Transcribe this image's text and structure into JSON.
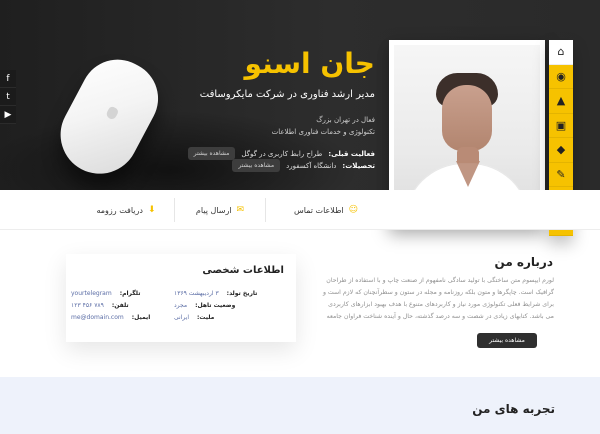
{
  "hero": {
    "name": "جان اسنو",
    "title": "مدیر ارشد فناوری در شرکت مایکروسافت",
    "meta_line1": "فعال در تهران بزرگ",
    "meta_line2": "تکنولوژی و خدمات فناوری اطلاعات",
    "activity_label": "فعالیت قبلی:",
    "activity_text": "طراح رابط کاربری در گوگل",
    "education_label": "تحصیلات:",
    "education_text": "دانشگاه آکسفورد",
    "more_button_1": "مشاهده بیشتر",
    "more_button_2": "مشاهده بیشتر"
  },
  "contact": {
    "contact_label": "اطلاعات تماس",
    "message_label": "ارسال پیام",
    "resume_label": "دریافت رزومه"
  },
  "about": {
    "title": "درباره من",
    "text": "لورم ایپسوم متن ساختگی با تولید سادگی نامفهوم از صنعت چاپ و با استفاده از طراحان گرافیک است. چاپگرها و متون بلکه روزنامه و مجله در ستون و سطرآنچنان که لازم است و برای شرایط فعلی تکنولوژی مورد نیاز و کاربردهای متنوع با هدف بهبود ابزارهای کاربردی می باشد. کتابهای زیادی در شصت و سه درصد گذشته، حال و آینده شناخت فراوان جامعه",
    "button": "مشاهده بیشتر"
  },
  "personal": {
    "title": "اطلاعات شخصی",
    "birth_label": "تاریخ تولد:",
    "birth_value": "۳ اردیبهشت ۱۳۶۹",
    "marital_label": "وضعیت تاهل:",
    "marital_value": "مجرد",
    "nationality_label": "ملیت:",
    "nationality_value": "ایرانی",
    "telegram_label": "تلگرام:",
    "telegram_value": "yourtelegram",
    "phone_label": "تلفن:",
    "phone_value": "۷۸۹ ۴۵۶ ۱۲۳",
    "email_label": "ایمیل:",
    "email_value": "me@domain.com"
  },
  "experience": {
    "title": "تجربه های من"
  },
  "colors": {
    "accent": "#f6c200",
    "dark": "#2a2a2a"
  }
}
